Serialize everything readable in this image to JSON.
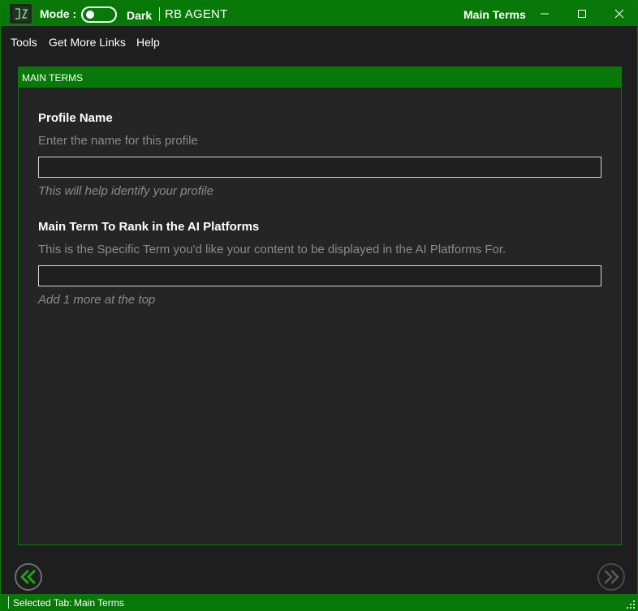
{
  "titlebar": {
    "mode_label": "Mode :",
    "mode_value": "Dark",
    "app_name": "RB AGENT",
    "window_title": "Main Terms",
    "icons": [
      "app-icon",
      "minimize-icon",
      "maximize-icon",
      "close-icon"
    ]
  },
  "menu": {
    "items": [
      {
        "label": "Tools"
      },
      {
        "label": "Get More Links"
      },
      {
        "label": "Help"
      }
    ]
  },
  "panel": {
    "header": "MAIN TERMS",
    "fields": [
      {
        "title": "Profile Name",
        "description": "Enter the name for this profile",
        "value": "",
        "hint": "This will help identify your profile"
      },
      {
        "title": "Main Term To Rank in the AI Platforms",
        "description": "This is the Specific Term you'd like your content to be displayed in the AI Platforms For.",
        "value": "",
        "hint": "Add 1 more at the top"
      }
    ]
  },
  "navigation": {
    "prev_icon": "double-chevron-left-icon",
    "next_icon": "double-chevron-right-icon"
  },
  "statusbar": {
    "label": "Selected Tab:",
    "value": "Main Terms"
  },
  "colors": {
    "accent": "#087808",
    "background": "#1e1e1e",
    "panel": "#252525",
    "muted_text": "#8a8a8a",
    "prev_arrow": "#1aa81a",
    "next_arrow": "#5a5a5a"
  }
}
